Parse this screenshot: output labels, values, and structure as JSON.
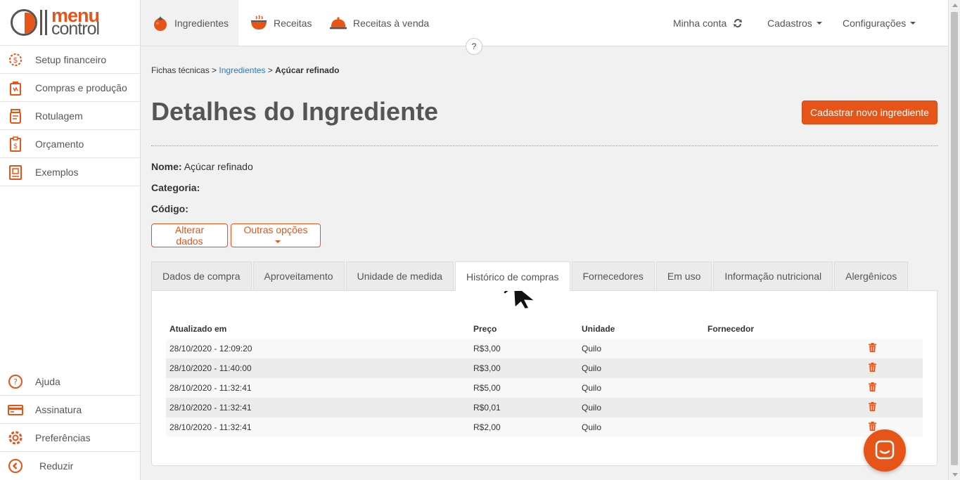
{
  "brand": {
    "name_top": "menu",
    "name_bottom": "control",
    "accent": "#e65418",
    "link": "#2a7ab8"
  },
  "sidebar": {
    "items": [
      {
        "label": "Setup financeiro",
        "icon": "dollar-gear-icon"
      },
      {
        "label": "Compras e produção",
        "icon": "shopping-bag-icon"
      },
      {
        "label": "Rotulagem",
        "icon": "jar-label-icon"
      },
      {
        "label": "Orçamento",
        "icon": "clipboard-dollar-icon"
      },
      {
        "label": "Exemplos",
        "icon": "book-image-icon"
      }
    ],
    "bottom_items": [
      {
        "label": "Ajuda",
        "icon": "question-bubble-icon"
      },
      {
        "label": "Assinatura",
        "icon": "credit-card-icon"
      },
      {
        "label": "Preferências",
        "icon": "gear-icon"
      },
      {
        "label": "Reduzir",
        "icon": "chevron-left-circle-icon"
      }
    ]
  },
  "topnav": {
    "tabs": [
      {
        "label": "Ingredientes",
        "icon": "tomato-icon"
      },
      {
        "label": "Receitas",
        "icon": "steaming-pot-icon"
      },
      {
        "label": "Receitas à venda",
        "icon": "cloche-icon"
      }
    ],
    "account": "Minha conta",
    "cadastros": "Cadastros",
    "configuracoes": "Configurações",
    "help": "?"
  },
  "breadcrumb": {
    "root": "Fichas técnicas",
    "sep": ">",
    "middle": "Ingredientes",
    "current": "Açúcar refinado"
  },
  "page": {
    "title": "Detalhes do Ingrediente",
    "new_button": "Cadastrar novo ingrediente",
    "fields": {
      "name_label": "Nome:",
      "name_value": "Açúcar refinado",
      "category_label": "Categoria:",
      "category_value": "",
      "code_label": "Código:",
      "code_value": ""
    },
    "edit_button": "Alterar dados",
    "more_button": "Outras opções"
  },
  "tabs": [
    "Dados de compra",
    "Aproveitamento",
    "Unidade de medida",
    "Histórico de compras",
    "Fornecedores",
    "Em uso",
    "Informação nutricional",
    "Alergênicos"
  ],
  "active_tab": "Histórico de compras",
  "history_table": {
    "headers": [
      "Atualizado em",
      "Preço",
      "Unidade",
      "Fornecedor"
    ],
    "rows": [
      [
        "28/10/2020 - 12:09:20",
        "R$3,00",
        "Quilo",
        ""
      ],
      [
        "28/10/2020 - 11:40:00",
        "R$3,00",
        "Quilo",
        ""
      ],
      [
        "28/10/2020 - 11:32:41",
        "R$5,00",
        "Quilo",
        ""
      ],
      [
        "28/10/2020 - 11:32:41",
        "R$0,01",
        "Quilo",
        ""
      ],
      [
        "28/10/2020 - 11:32:41",
        "R$2,00",
        "Quilo",
        ""
      ]
    ]
  }
}
